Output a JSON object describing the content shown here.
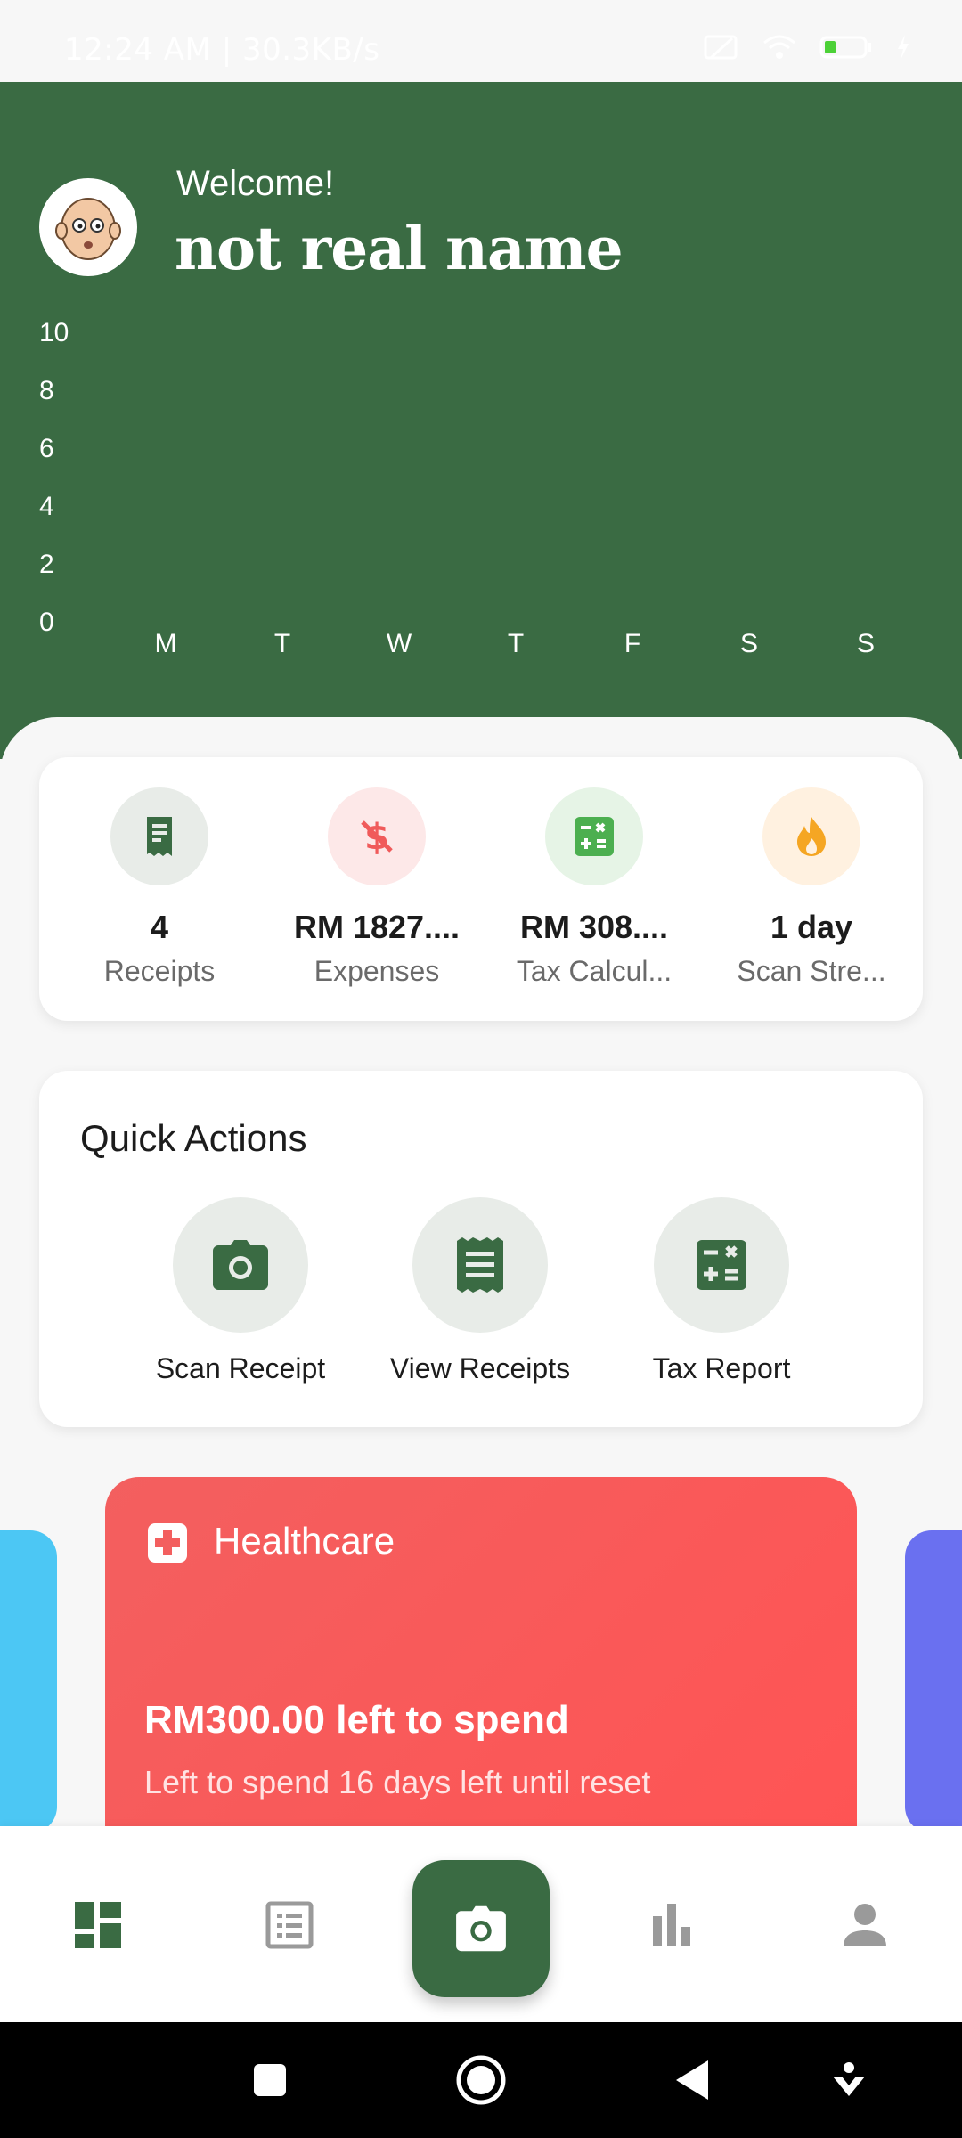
{
  "status_bar": {
    "time_speed": "12:24 AM | 30.3KB/s",
    "battery": "28"
  },
  "header": {
    "welcome": "Welcome!",
    "username": "not real name"
  },
  "chart_data": {
    "type": "bar",
    "categories": [
      "M",
      "T",
      "W",
      "T",
      "F",
      "S",
      "S"
    ],
    "values": [
      0,
      0,
      0,
      0,
      0,
      0,
      0
    ],
    "title": "",
    "xlabel": "",
    "ylabel": "",
    "ylim": [
      0,
      10
    ],
    "yticks": [
      "10",
      "8",
      "6",
      "4",
      "2",
      "0"
    ],
    "grid": false
  },
  "stats": [
    {
      "value": "4",
      "label": "Receipts",
      "icon": "receipt-icon",
      "color": "#3a6b43",
      "bg": "#e8ece8"
    },
    {
      "value": "RM 1827....",
      "label": "Expenses",
      "icon": "money-off-icon",
      "color": "#f05a5a",
      "bg": "#fde8e8"
    },
    {
      "value": "RM 308....",
      "label": "Tax Calcul...",
      "icon": "calculator-icon",
      "color": "#4caf50",
      "bg": "#e6f4e6"
    },
    {
      "value": "1 day",
      "label": "Scan Stre...",
      "icon": "fire-icon",
      "color": "#f5a623",
      "bg": "#fff1e0"
    }
  ],
  "quick_actions": {
    "title": "Quick Actions",
    "items": [
      {
        "label": "Scan Receipt",
        "icon": "camera-icon"
      },
      {
        "label": "View Receipts",
        "icon": "receipt-list-icon"
      },
      {
        "label": "Tax Report",
        "icon": "calculator-icon"
      }
    ]
  },
  "budget_card": {
    "category": "Healthcare",
    "left_to_spend": "RM300.00 left to spend",
    "subtitle": "Left to spend 16 days left until reset",
    "color": "#ff5858"
  },
  "bottom_nav": {
    "items": [
      "dashboard-icon",
      "list-icon",
      "camera-icon",
      "bar-chart-icon",
      "person-icon"
    ],
    "active": "dashboard-icon",
    "accent": "#3a6b43"
  },
  "colors": {
    "primary": "#3a6b43",
    "background": "#f7f7f7"
  }
}
